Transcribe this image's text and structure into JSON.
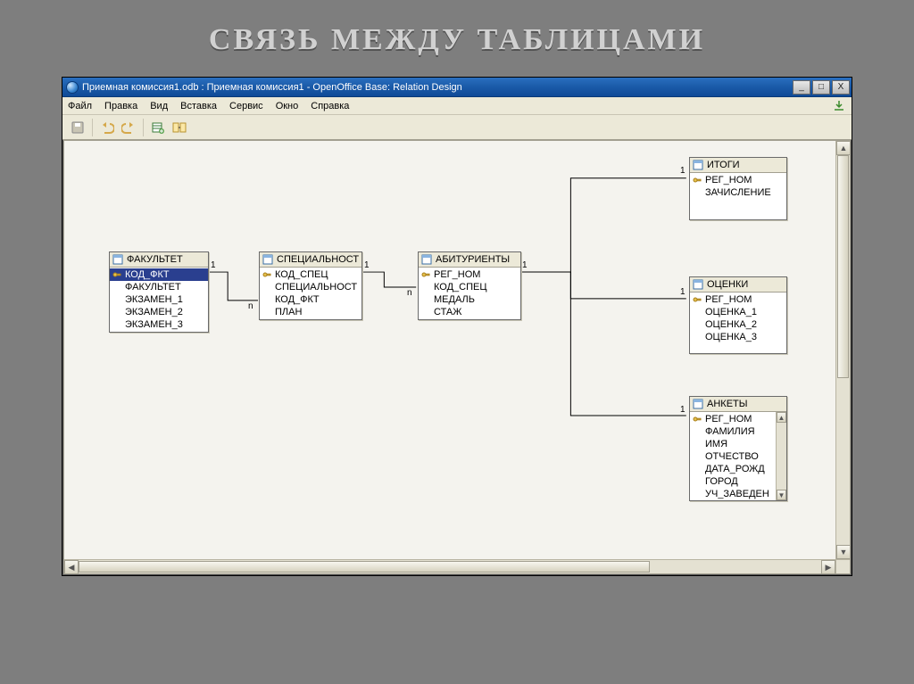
{
  "slide_title": "СВЯЗЬ МЕЖДУ ТАБЛИЦАМИ",
  "window_title": "Приемная комиссия1.odb : Приемная комиссия1 - OpenOffice Base: Relation Design",
  "menu": {
    "file": "Файл",
    "edit": "Правка",
    "view": "Вид",
    "insert": "Вставка",
    "tools": "Сервис",
    "window": "Окно",
    "help": "Справка"
  },
  "win_btns": {
    "min": "_",
    "max": "□",
    "close": "X"
  },
  "tables": {
    "fakultet": {
      "title": "ФАКУЛЬТЕТ",
      "fields": [
        "КОД_ФКТ",
        "ФАКУЛЬТЕТ",
        "ЭКЗАМЕН_1",
        "ЭКЗАМЕН_2",
        "ЭКЗАМЕН_3"
      ],
      "key_index": 0,
      "selected_index": 0
    },
    "specialnost": {
      "title": "СПЕЦИАЛЬНОСТ",
      "fields": [
        "КОД_СПЕЦ",
        "СПЕЦИАЛЬНОСТ",
        "КОД_ФКТ",
        "ПЛАН"
      ],
      "key_index": 0
    },
    "abiturienty": {
      "title": "АБИТУРИЕНТЫ",
      "fields": [
        "РЕГ_НОМ",
        "КОД_СПЕЦ",
        "МЕДАЛЬ",
        "СТАЖ"
      ],
      "key_index": 0
    },
    "itogi": {
      "title": "ИТОГИ",
      "fields": [
        "РЕГ_НОМ",
        "ЗАЧИСЛЕНИЕ"
      ],
      "key_index": 0
    },
    "ocenki": {
      "title": "ОЦЕНКИ",
      "fields": [
        "РЕГ_НОМ",
        "ОЦЕНКА_1",
        "ОЦЕНКА_2",
        "ОЦЕНКА_3"
      ],
      "key_index": 0
    },
    "ankety": {
      "title": "АНКЕТЫ",
      "fields": [
        "РЕГ_НОМ",
        "ФАМИЛИЯ",
        "ИМЯ",
        "ОТЧЕСТВО",
        "ДАТА_РОЖД",
        "ГОРОД",
        "УЧ_ЗАВЕДЕН"
      ],
      "key_index": 0
    }
  },
  "cardinality": {
    "one": "1",
    "many": "n"
  },
  "chart_data": {
    "type": "diagram",
    "description": "Entity-relationship diagram of database tables and their one-to-many / one-to-one relationships in OpenOffice Base Relation Design",
    "entities": [
      {
        "name": "ФАКУЛЬТЕТ",
        "primary_key": "КОД_ФКТ",
        "fields": [
          "КОД_ФКТ",
          "ФАКУЛЬТЕТ",
          "ЭКЗАМЕН_1",
          "ЭКЗАМЕН_2",
          "ЭКЗАМЕН_3"
        ]
      },
      {
        "name": "СПЕЦИАЛЬНОСТ",
        "primary_key": "КОД_СПЕЦ",
        "fields": [
          "КОД_СПЕЦ",
          "СПЕЦИАЛЬНОСТ",
          "КОД_ФКТ",
          "ПЛАН"
        ]
      },
      {
        "name": "АБИТУРИЕНТЫ",
        "primary_key": "РЕГ_НОМ",
        "fields": [
          "РЕГ_НОМ",
          "КОД_СПЕЦ",
          "МЕДАЛЬ",
          "СТАЖ"
        ]
      },
      {
        "name": "ИТОГИ",
        "primary_key": "РЕГ_НОМ",
        "fields": [
          "РЕГ_НОМ",
          "ЗАЧИСЛЕНИЕ"
        ]
      },
      {
        "name": "ОЦЕНКИ",
        "primary_key": "РЕГ_НОМ",
        "fields": [
          "РЕГ_НОМ",
          "ОЦЕНКА_1",
          "ОЦЕНКА_2",
          "ОЦЕНКА_3"
        ]
      },
      {
        "name": "АНКЕТЫ",
        "primary_key": "РЕГ_НОМ",
        "fields": [
          "РЕГ_НОМ",
          "ФАМИЛИЯ",
          "ИМЯ",
          "ОТЧЕСТВО",
          "ДАТА_РОЖД",
          "ГОРОД",
          "УЧ_ЗАВЕДЕН"
        ]
      }
    ],
    "relationships": [
      {
        "from": "ФАКУЛЬТЕТ",
        "from_field": "КОД_ФКТ",
        "from_card": "1",
        "to": "СПЕЦИАЛЬНОСТ",
        "to_field": "КОД_ФКТ",
        "to_card": "n"
      },
      {
        "from": "СПЕЦИАЛЬНОСТ",
        "from_field": "КОД_СПЕЦ",
        "from_card": "1",
        "to": "АБИТУРИЕНТЫ",
        "to_field": "КОД_СПЕЦ",
        "to_card": "n"
      },
      {
        "from": "АБИТУРИЕНТЫ",
        "from_field": "РЕГ_НОМ",
        "from_card": "1",
        "to": "ИТОГИ",
        "to_field": "РЕГ_НОМ",
        "to_card": "1"
      },
      {
        "from": "АБИТУРИЕНТЫ",
        "from_field": "РЕГ_НОМ",
        "from_card": "1",
        "to": "ОЦЕНКИ",
        "to_field": "РЕГ_НОМ",
        "to_card": "1"
      },
      {
        "from": "АБИТУРИЕНТЫ",
        "from_field": "РЕГ_НОМ",
        "from_card": "1",
        "to": "АНКЕТЫ",
        "to_field": "РЕГ_НОМ",
        "to_card": "1"
      }
    ]
  }
}
